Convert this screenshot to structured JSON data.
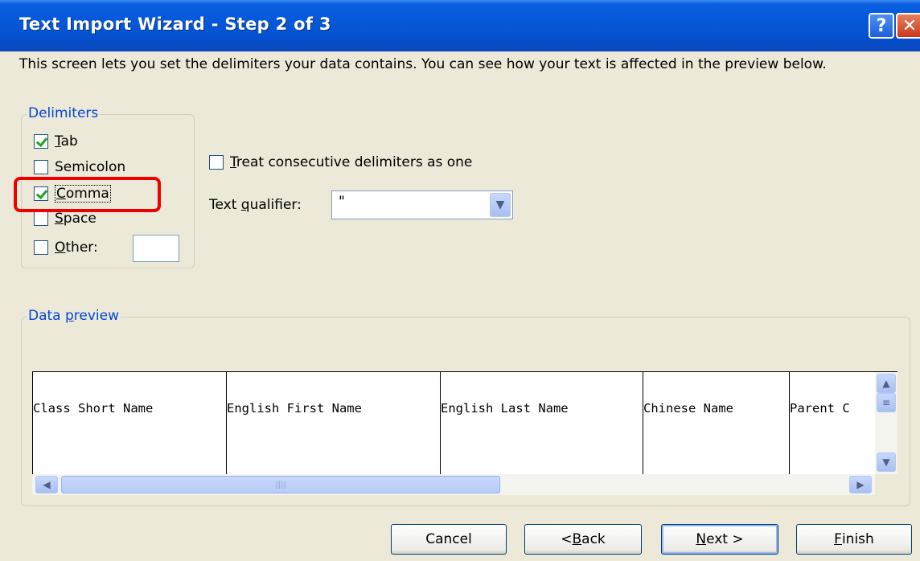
{
  "window": {
    "title": "Text Import Wizard - Step 2 of 3",
    "help_glyph": "?",
    "close_glyph": "✕"
  },
  "description": "This screen lets you set the delimiters your data contains.  You can see how your text is affected in the preview below.",
  "delimiters": {
    "legend": "Delimiters",
    "items": [
      {
        "key": "T",
        "rest": "ab",
        "checked": true
      },
      {
        "key": "",
        "rest": "Semicolon",
        "checked": false
      },
      {
        "key": "C",
        "rest": "omma",
        "checked": true
      },
      {
        "key": "S",
        "rest": "pace",
        "checked": false
      },
      {
        "key": "O",
        "rest": "ther:",
        "checked": false
      }
    ],
    "other_value": ""
  },
  "options": {
    "consecutive_key": "T",
    "consecutive_rest": "reat consecutive delimiters as one",
    "consecutive_checked": false,
    "qualifier_pre": "Text ",
    "qualifier_key": "q",
    "qualifier_post": "ualifier:",
    "qualifier_value": "\""
  },
  "preview": {
    "legend_pre": "Data ",
    "legend_key": "p",
    "legend_post": "review",
    "columns": [
      "Class Short Name",
      "English First Name",
      "English Last Name",
      "Chinese Name",
      "Parent C"
    ]
  },
  "buttons": {
    "cancel": "Cancel",
    "back_pre": "< ",
    "back_key": "B",
    "back_post": "ack",
    "next_key": "N",
    "next_post": "ext >",
    "finish_key": "F",
    "finish_post": "inish"
  },
  "colors": {
    "titlebar": "#0559d8",
    "legend_text": "#0046d5",
    "highlight": "#e00000",
    "checkmark": "#21a121"
  }
}
